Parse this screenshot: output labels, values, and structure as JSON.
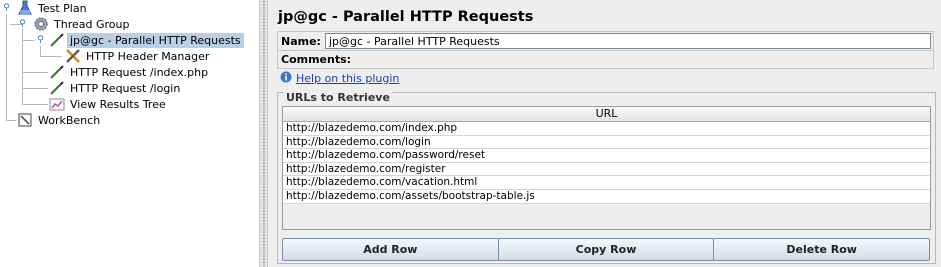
{
  "tree": {
    "test_plan": "Test Plan",
    "thread_group": "Thread Group",
    "parallel_requests": "jp@gc - Parallel HTTP Requests",
    "header_manager": "HTTP Header Manager",
    "request_index": "HTTP Request /index.php",
    "request_login": "HTTP Request /login",
    "results_tree": "View Results Tree",
    "workbench": "WorkBench"
  },
  "panel": {
    "title": "jp@gc - Parallel HTTP Requests",
    "name_label": "Name:",
    "name_value": "jp@gc - Parallel HTTP Requests",
    "comments_label": "Comments:",
    "help_link": "Help on this plugin"
  },
  "urls": {
    "group_title": "URLs to Retrieve",
    "column_header": "URL",
    "rows": [
      "http://blazedemo.com/index.php",
      "http://blazedemo.com/login",
      "http://blazedemo.com/password/reset",
      "http://blazedemo.com/register",
      "http://blazedemo.com/vacation.html",
      "http://blazedemo.com/assets/bootstrap-table.js"
    ]
  },
  "buttons": {
    "add_row": "Add Row",
    "copy_row": "Copy Row",
    "delete_row": "Delete Row"
  }
}
